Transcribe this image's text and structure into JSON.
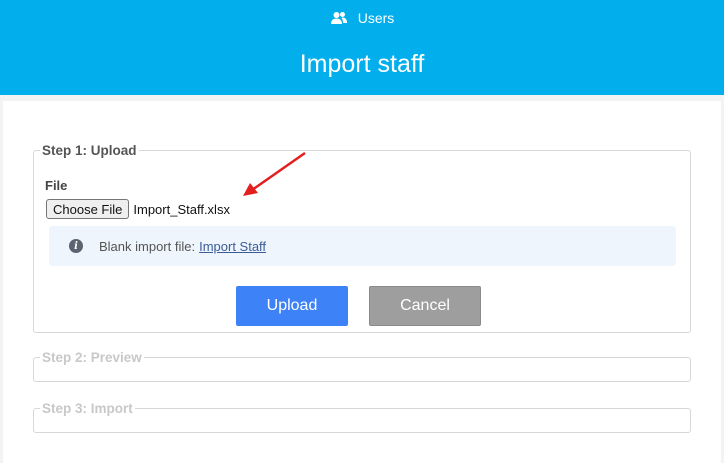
{
  "header": {
    "breadcrumb_label": "Users",
    "breadcrumb_icon": "users-icon",
    "title": "Import staff",
    "background_color": "#02aeec"
  },
  "step1": {
    "legend": "Step 1: Upload",
    "file_label": "File",
    "choose_file_label": "Choose File",
    "chosen_file_name": "Import_Staff.xlsx",
    "info_text": "Blank import file:",
    "info_link": "Import Staff",
    "info_icon": "info-icon",
    "upload_label": "Upload",
    "cancel_label": "Cancel",
    "upload_color": "#3e82f7",
    "annotation_color": "#e31e1e"
  },
  "step2": {
    "legend": "Step 2: Preview"
  },
  "step3": {
    "legend": "Step 3: Import"
  }
}
